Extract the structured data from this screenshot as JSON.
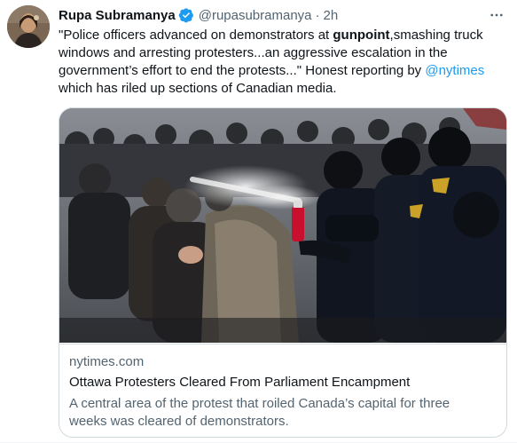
{
  "tweet": {
    "author": {
      "display_name": "Rupa Subramanya",
      "handle": "@rupasubramanya",
      "separator": "·",
      "time": "2h",
      "verified": true
    },
    "text": {
      "part1": "\"Police officers advanced on demonstrators at ",
      "bold": "gunpoint",
      "part2": ",smashing truck windows and arresting protesters...an aggressive escalation in the government’s effort to end the protests...\" Honest reporting by ",
      "mention": "@nytimes",
      "part3": " which has riled up sections of Canadian media."
    },
    "more_icon": "more-horizontal-icon",
    "colors": {
      "accent": "#1d9bf0",
      "text": "#0f1419",
      "secondary": "#536471",
      "border": "#cfd9de"
    }
  },
  "card": {
    "domain": "nytimes.com",
    "title": "Ottawa Protesters Cleared From Parliament Encampment",
    "description": "A central area of the protest that roiled Canada’s capital for three weeks was cleared of demonstrators."
  }
}
